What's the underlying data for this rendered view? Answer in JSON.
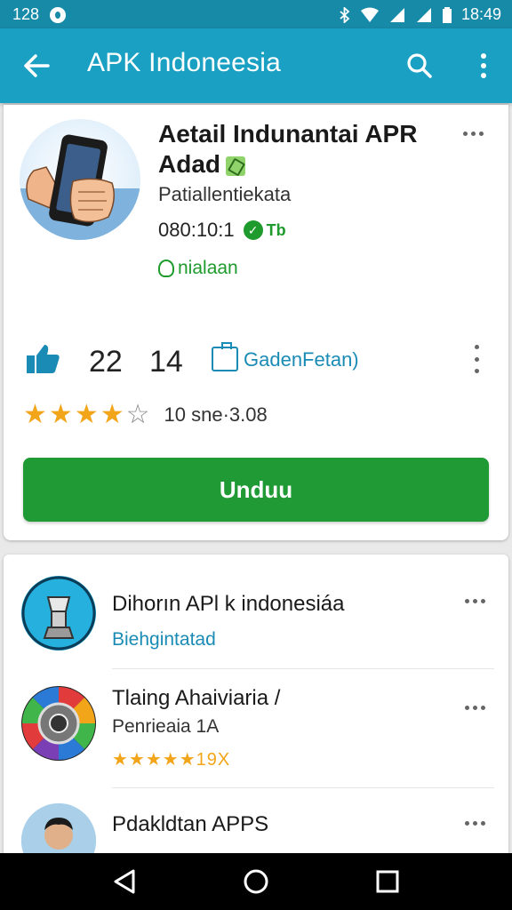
{
  "status_bar": {
    "notification_count": "128",
    "time": "18:49"
  },
  "app_bar": {
    "title": "APK Indoneesia"
  },
  "app": {
    "title": "Aetail Indunantai APR Adad",
    "developer": "Patiallentiekata",
    "meta": "080:10:1",
    "meta_suffix": "Tb",
    "install_status": "nialaan",
    "likes": "22",
    "shares": "14",
    "category": "GadenFetan)",
    "rating_stars": 4,
    "rating_text": "10 sne·3.08",
    "download_label": "Unduu"
  },
  "related": [
    {
      "title": "Dihorın APl k indonesiáa",
      "subtitle": "Biehgintatad",
      "subtitle_color": "#1a8bb5"
    },
    {
      "title": "Tlaing Ahaiviaria  /",
      "subtitle": "Penrieaia 1A",
      "rating": "★★★★★19X"
    },
    {
      "title": "Pdakldtan APPS",
      "subtitle": ""
    }
  ],
  "colors": {
    "primary": "#1aa0c2",
    "status_bar": "#178aa8",
    "accent_green": "#1f9a34",
    "accent_blue": "#1a8bb5",
    "star": "#f3a51a"
  }
}
